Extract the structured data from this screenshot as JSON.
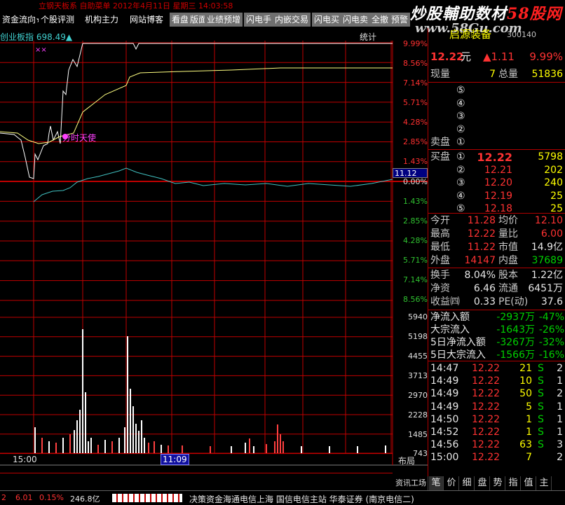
{
  "top_info": "立钢天板系  自助菜单  2012年4月11日 星期三  14:03:58",
  "tabs": [
    "资金流向★",
    "个股评测",
    "机构主力",
    "网站博客",
    "看盘",
    "版面",
    "业绩预增",
    "闪电手",
    "内嵌交易",
    "闪电买",
    "闪电卖",
    "全撤",
    "预警"
  ],
  "watermark": {
    "brand": "炒股輔助数材",
    "site_num": "58",
    "site_suffix": "股网",
    "url": "www.58Gu.com"
  },
  "chart": {
    "index_label": "创业板指",
    "index_value": "698.49",
    "index_arrow": "▲",
    "stats_label": "统计",
    "marks": "××",
    "annotation": "分时天使",
    "cursor_value": "11.12",
    "time_labels": [
      "15:00",
      "11:09"
    ],
    "layout_btn": "布局",
    "pct_labels_up": [
      "9.99%",
      "8.56%",
      "7.14%",
      "5.71%",
      "4.28%",
      "2.85%",
      "1.43%",
      "0.00%"
    ],
    "pct_labels_down": [
      "1.43%",
      "2.85%",
      "4.28%",
      "5.71%",
      "7.14%",
      "8.56%"
    ],
    "volume_labels": [
      "5940",
      "5198",
      "4455",
      "3713",
      "2970",
      "2228",
      "1485",
      "743"
    ]
  },
  "panel": {
    "title": "启源装备",
    "code": "300140",
    "price": "12.22",
    "price_unit": "元",
    "change": "▲1.11",
    "change_pct": "9.99%",
    "now_label": "现量",
    "now_val": "7",
    "total_label": "总量",
    "total_val": "51836",
    "sell_rows": [
      "⑤",
      "④",
      "③",
      "②",
      "①"
    ],
    "sell_label": "卖盘",
    "buy_label": "买盘",
    "buy_rows": [
      {
        "idx": "①",
        "price": "12.22",
        "vol": "5798"
      },
      {
        "idx": "②",
        "price": "12.21",
        "vol": "202"
      },
      {
        "idx": "③",
        "price": "12.20",
        "vol": "240"
      },
      {
        "idx": "④",
        "price": "12.19",
        "vol": "25"
      },
      {
        "idx": "⑤",
        "price": "12.18",
        "vol": "25"
      }
    ],
    "stats": [
      {
        "l1": "今开",
        "v1": "11.28",
        "l2": "均价",
        "v2": "12.10"
      },
      {
        "l1": "最高",
        "v1": "12.22",
        "l2": "量比",
        "v2": "6.00"
      },
      {
        "l1": "最低",
        "v1": "11.22",
        "l2": "市值",
        "v2": "14.9亿"
      },
      {
        "l1": "外盘",
        "v1": "14147",
        "l2": "内盘",
        "v2": "37689"
      }
    ],
    "stats2": [
      {
        "l1": "换手",
        "v1": "8.04%",
        "l2": "股本",
        "v2": "1.22亿"
      },
      {
        "l1": "净资",
        "v1": "6.46",
        "l2": "流通",
        "v2": "6451万"
      },
      {
        "l1": "收益㈣",
        "v1": "0.33",
        "l2": "PE(动)",
        "v2": "37.6"
      }
    ],
    "flows": [
      {
        "label": "净流入额",
        "val": "-2937万",
        "pct": "-47%"
      },
      {
        "label": "大宗流入",
        "val": "-1643万",
        "pct": "-26%"
      },
      {
        "label": "5日净流入额",
        "val": "-3267万",
        "pct": "-32%"
      },
      {
        "label": "5日大宗流入",
        "val": "-1566万",
        "pct": "-16%"
      }
    ],
    "ticks": [
      {
        "time": "14:47",
        "price": "12.22",
        "vol": "21",
        "bs": "S",
        "n": "2"
      },
      {
        "time": "14:49",
        "price": "12.22",
        "vol": "10",
        "bs": "S",
        "n": "1"
      },
      {
        "time": "14:49",
        "price": "12.22",
        "vol": "50",
        "bs": "S",
        "n": "2"
      },
      {
        "time": "14:49",
        "price": "12.22",
        "vol": "5",
        "bs": "S",
        "n": "1"
      },
      {
        "time": "14:50",
        "price": "12.22",
        "vol": "1",
        "bs": "S",
        "n": "1"
      },
      {
        "time": "14:52",
        "price": "12.22",
        "vol": "1",
        "bs": "S",
        "n": "1"
      },
      {
        "time": "14:56",
        "price": "12.22",
        "vol": "63",
        "bs": "S",
        "n": "3"
      },
      {
        "time": "15:00",
        "price": "12.22",
        "vol": "7",
        "bs": "",
        "n": "2"
      }
    ],
    "bottom_tabs": [
      "资讯工场",
      "笔",
      "价",
      "细",
      "盘",
      "势",
      "指",
      "值",
      "主"
    ]
  },
  "bottom": {
    "p1": "2",
    "p2": "6.01",
    "p3": "0.15%",
    "p4": "246.8亿",
    "news": "决策资金海通电信上海  国信电信主站  华泰证券 (南京电信二)"
  },
  "colors": {
    "red_line": "#c00000",
    "price_line": "#ffffff",
    "avg_line": "#ffff00",
    "index_line": "#40c0c0"
  }
}
